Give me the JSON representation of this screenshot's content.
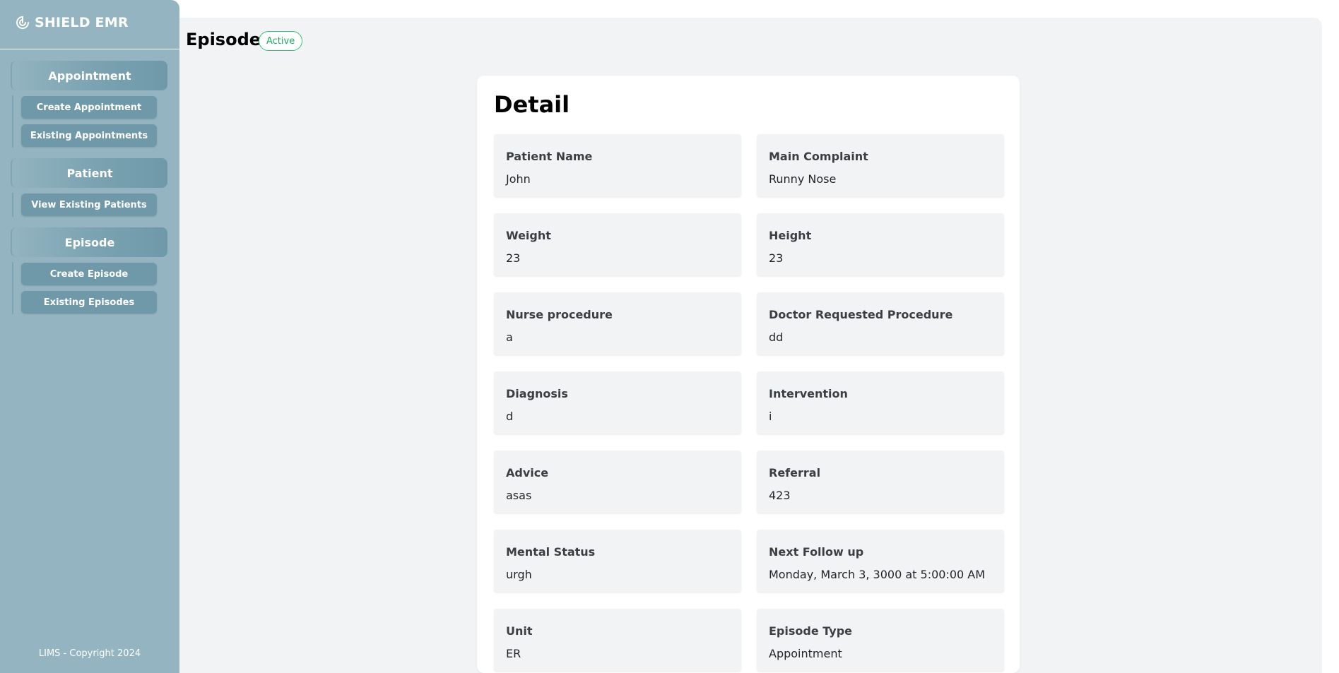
{
  "brand": {
    "name": "SHIELD EMR",
    "icon": "shield-swirl-icon"
  },
  "nav": {
    "appointment": {
      "label": "Appointment",
      "items": [
        "Create Appointment",
        "Existing Appointments"
      ]
    },
    "patient": {
      "label": "Patient",
      "items": [
        "View Existing Patients"
      ]
    },
    "episode": {
      "label": "Episode",
      "items": [
        "Create Episode",
        "Existing Episodes"
      ]
    }
  },
  "footer": "LIMS - Copyright 2024",
  "page": {
    "title": "Episode",
    "status": "Active"
  },
  "detail": {
    "title": "Detail",
    "fields": [
      {
        "label": "Patient Name",
        "value": "John"
      },
      {
        "label": "Main Complaint",
        "value": "Runny Nose"
      },
      {
        "label": "Weight",
        "value": "23"
      },
      {
        "label": "Height",
        "value": "23"
      },
      {
        "label": "Nurse procedure",
        "value": "a"
      },
      {
        "label": "Doctor Requested Procedure",
        "value": "dd"
      },
      {
        "label": "Diagnosis",
        "value": "d"
      },
      {
        "label": "Intervention",
        "value": "i"
      },
      {
        "label": "Advice",
        "value": "asas"
      },
      {
        "label": "Referral",
        "value": "423"
      },
      {
        "label": "Mental Status",
        "value": "urgh"
      },
      {
        "label": "Next Follow up",
        "value": "Monday, March 3, 3000 at 5:00:00 AM"
      },
      {
        "label": "Unit",
        "value": "ER"
      },
      {
        "label": "Episode Type",
        "value": "Appointment"
      }
    ]
  },
  "colors": {
    "sidebar": "#93b4c0",
    "nav_button": "#6f99a9",
    "content_bg": "#f2f3f5",
    "badge_green": "#34c27a"
  }
}
